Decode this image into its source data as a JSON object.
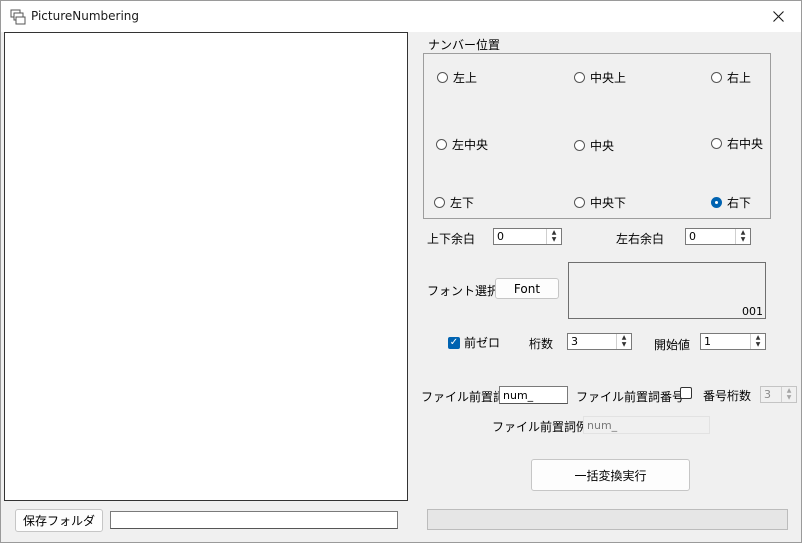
{
  "window": {
    "title": "PictureNumbering"
  },
  "position_group": {
    "label": "ナンバー位置",
    "options": [
      {
        "label": "左上",
        "checked": false
      },
      {
        "label": "中央上",
        "checked": false
      },
      {
        "label": "右上",
        "checked": false
      },
      {
        "label": "左中央",
        "checked": false
      },
      {
        "label": "中央",
        "checked": false
      },
      {
        "label": "右中央",
        "checked": false
      },
      {
        "label": "左下",
        "checked": false
      },
      {
        "label": "中央下",
        "checked": false
      },
      {
        "label": "右下",
        "checked": true
      }
    ]
  },
  "margins": {
    "vertical_label": "上下余白",
    "vertical_value": "0",
    "horizontal_label": "左右余白",
    "horizontal_value": "0"
  },
  "font": {
    "label": "フォント選択",
    "button_label": "Font",
    "preview_sample": "001"
  },
  "numbering": {
    "zero_pad_label": "前ゼロ",
    "zero_pad_checked": true,
    "digits_label": "桁数",
    "digits_value": "3",
    "start_label": "開始値",
    "start_value": "1"
  },
  "prefix": {
    "label": "ファイル前置詞",
    "value": "num_",
    "number_label": "ファイル前置詞番号",
    "number_checked": false,
    "number_digits_label": "番号桁数",
    "number_digits_value": "3",
    "example_label": "ファイル前置詞例",
    "example_value": "num_"
  },
  "actions": {
    "execute_label": "一括変換実行",
    "save_folder_label": "保存フォルダ",
    "save_folder_path": ""
  },
  "progress": {
    "percent": 0
  }
}
